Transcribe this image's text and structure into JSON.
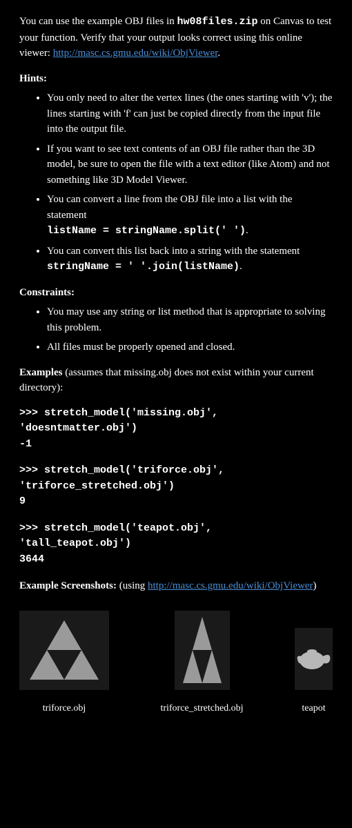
{
  "intro_p1a": "You can use the example OBJ files in ",
  "intro_p1b": "hw08files.zip",
  "intro_p1c": " on Canvas to test your function. Verify that your output looks correct using this online viewer: ",
  "intro_link": "http://masc.cs.gmu.edu/wiki/ObjViewer",
  "intro_p1d": ".",
  "hints_heading": "Hints:",
  "hints": {
    "h1": "You only need to alter the vertex lines (the ones starting with 'v'); the lines starting with 'f' can just be copied directly from the input file into the output file.",
    "h2": "If you want to see text contents of an OBJ file rather than the 3D model, be sure to open the file with a text editor (like Atom) and not something like 3D Model Viewer.",
    "h3a": "You can convert a line from the OBJ file into a list with the statement",
    "h3b": "listName = stringName.split(' ')",
    "h3c": ".",
    "h4a": "You can convert this list back into a string with the statement",
    "h4b": "stringName = ' '.join(listName)",
    "h4c": "."
  },
  "constraints_heading": "Constraints:",
  "constraints": {
    "c1": "You may use any string or list method that is appropriate to solving this problem.",
    "c2": "All files must be properly opened and closed."
  },
  "examples_heading_a": "Examples",
  "examples_heading_b": " (assumes that missing.obj does not exist within your current directory):",
  "code1": ">>> stretch_model('missing.obj',\n'doesntmatter.obj')\n-1",
  "code2": ">>> stretch_model('triforce.obj',\n'triforce_stretched.obj')\n9",
  "code3": ">>> stretch_model('teapot.obj',\n'tall_teapot.obj')\n3644",
  "screenshots_heading_a": "Example Screenshots:",
  "screenshots_heading_b": " (using ",
  "screenshots_link": "http://masc.cs.gmu.edu/wiki/ObjViewer",
  "screenshots_heading_c": ")",
  "captions": {
    "c1": "triforce.obj",
    "c2": "triforce_stretched.obj",
    "c3": "teapot"
  }
}
